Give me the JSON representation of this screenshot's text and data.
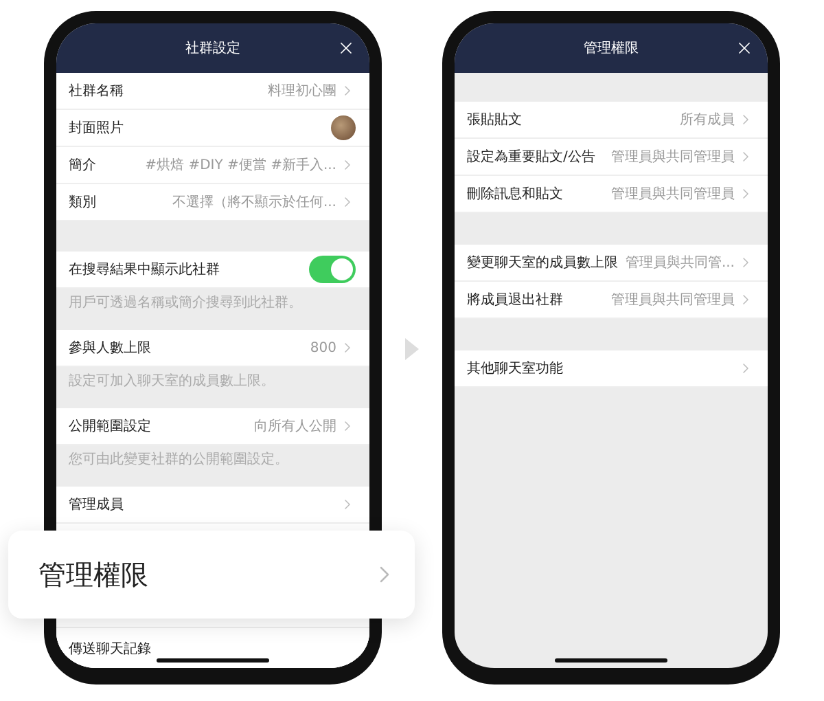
{
  "screens": [
    {
      "title": "社群設定",
      "sections": [
        {
          "rows": [
            {
              "kind": "value",
              "label": "社群名稱",
              "value": "料理初心團"
            },
            {
              "kind": "photo",
              "label": "封面照片"
            },
            {
              "kind": "value",
              "label": "簡介",
              "value": "#烘焙 #DIY #便當 #新手入..."
            },
            {
              "kind": "value",
              "label": "類別",
              "value": "不選擇（將不顯示於任何..."
            }
          ]
        },
        {
          "rows": [
            {
              "kind": "toggle",
              "label": "在搜尋結果中顯示此社群",
              "on": true
            }
          ],
          "hint": "用戶可透過名稱或簡介搜尋到此社群。"
        },
        {
          "rows": [
            {
              "kind": "value",
              "label": "參與人數上限",
              "value": "800"
            }
          ],
          "hint": "設定可加入聊天室的成員數上限。"
        },
        {
          "rows": [
            {
              "kind": "value",
              "label": "公開範圍設定",
              "value": "向所有人公開"
            }
          ],
          "hint": "您可由此變更社群的公開範圍設定。"
        },
        {
          "rows": [
            {
              "kind": "link",
              "label": "管理成員"
            },
            {
              "kind": "covered"
            },
            {
              "kind": "plain",
              "label": "傳送聊天記錄"
            }
          ]
        }
      ]
    },
    {
      "title": "管理權限",
      "sections": [
        {
          "rows": [
            {
              "kind": "value",
              "label": "張貼貼文",
              "value": "所有成員"
            },
            {
              "kind": "value",
              "label": "設定為重要貼文/公告",
              "value": "管理員與共同管理員"
            },
            {
              "kind": "value",
              "label": "刪除訊息和貼文",
              "value": "管理員與共同管理員"
            }
          ]
        },
        {
          "rows": [
            {
              "kind": "value",
              "label": "變更聊天室的成員數上限",
              "value": "管理員與共同管..."
            },
            {
              "kind": "value",
              "label": "將成員退出社群",
              "value": "管理員與共同管理員"
            }
          ]
        },
        {
          "rows": [
            {
              "kind": "link",
              "label": "其他聊天室功能"
            }
          ]
        }
      ]
    }
  ],
  "highlight": {
    "label": "管理權限"
  }
}
